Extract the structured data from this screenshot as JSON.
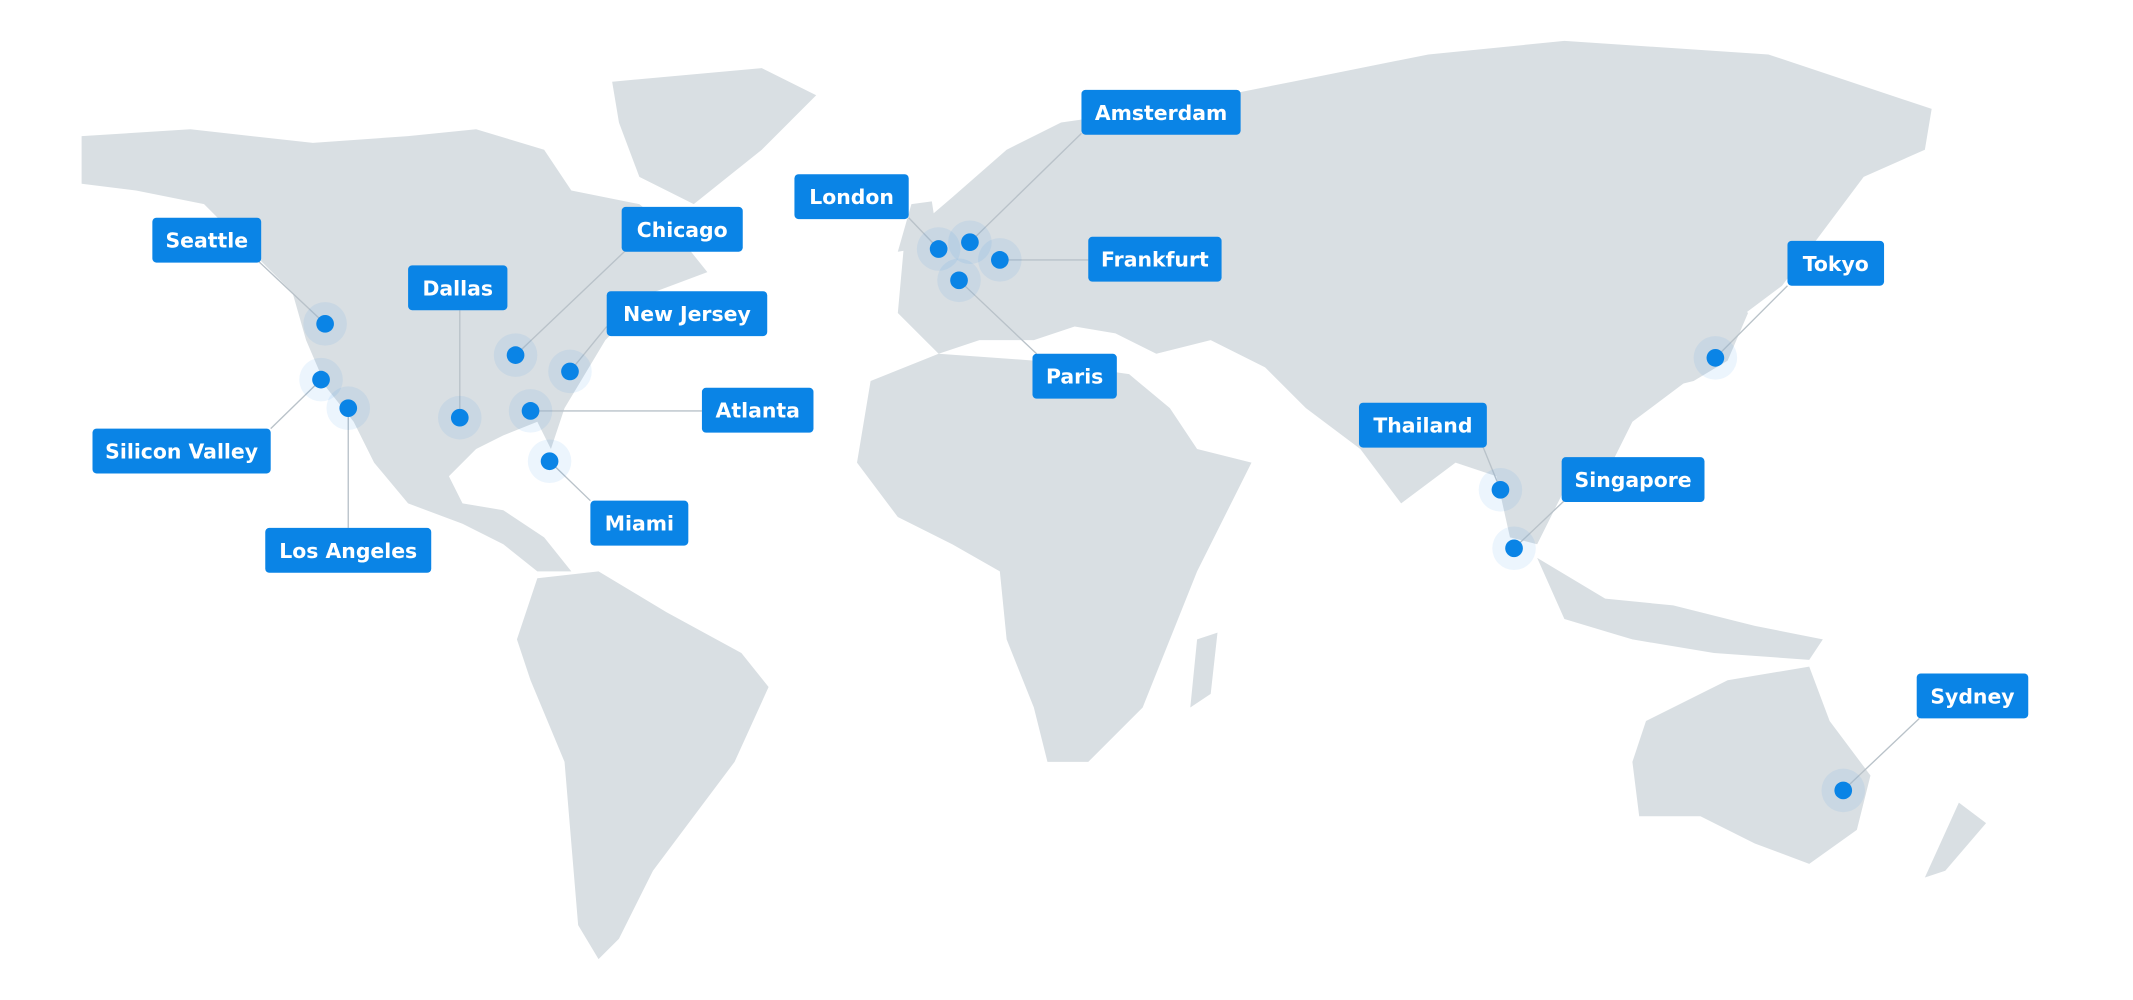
{
  "colors": {
    "land": "#d9dfe3",
    "accent": "#0a84e6",
    "label_text": "#ffffff",
    "background": "#ffffff"
  },
  "locations": [
    {
      "name": "Seattle"
    },
    {
      "name": "Silicon Valley"
    },
    {
      "name": "Los Angeles"
    },
    {
      "name": "Dallas"
    },
    {
      "name": "Chicago"
    },
    {
      "name": "New Jersey"
    },
    {
      "name": "Atlanta"
    },
    {
      "name": "Miami"
    },
    {
      "name": "London"
    },
    {
      "name": "Amsterdam"
    },
    {
      "name": "Frankfurt"
    },
    {
      "name": "Paris"
    },
    {
      "name": "Thailand"
    },
    {
      "name": "Singapore"
    },
    {
      "name": "Tokyo"
    },
    {
      "name": "Sydney"
    }
  ]
}
